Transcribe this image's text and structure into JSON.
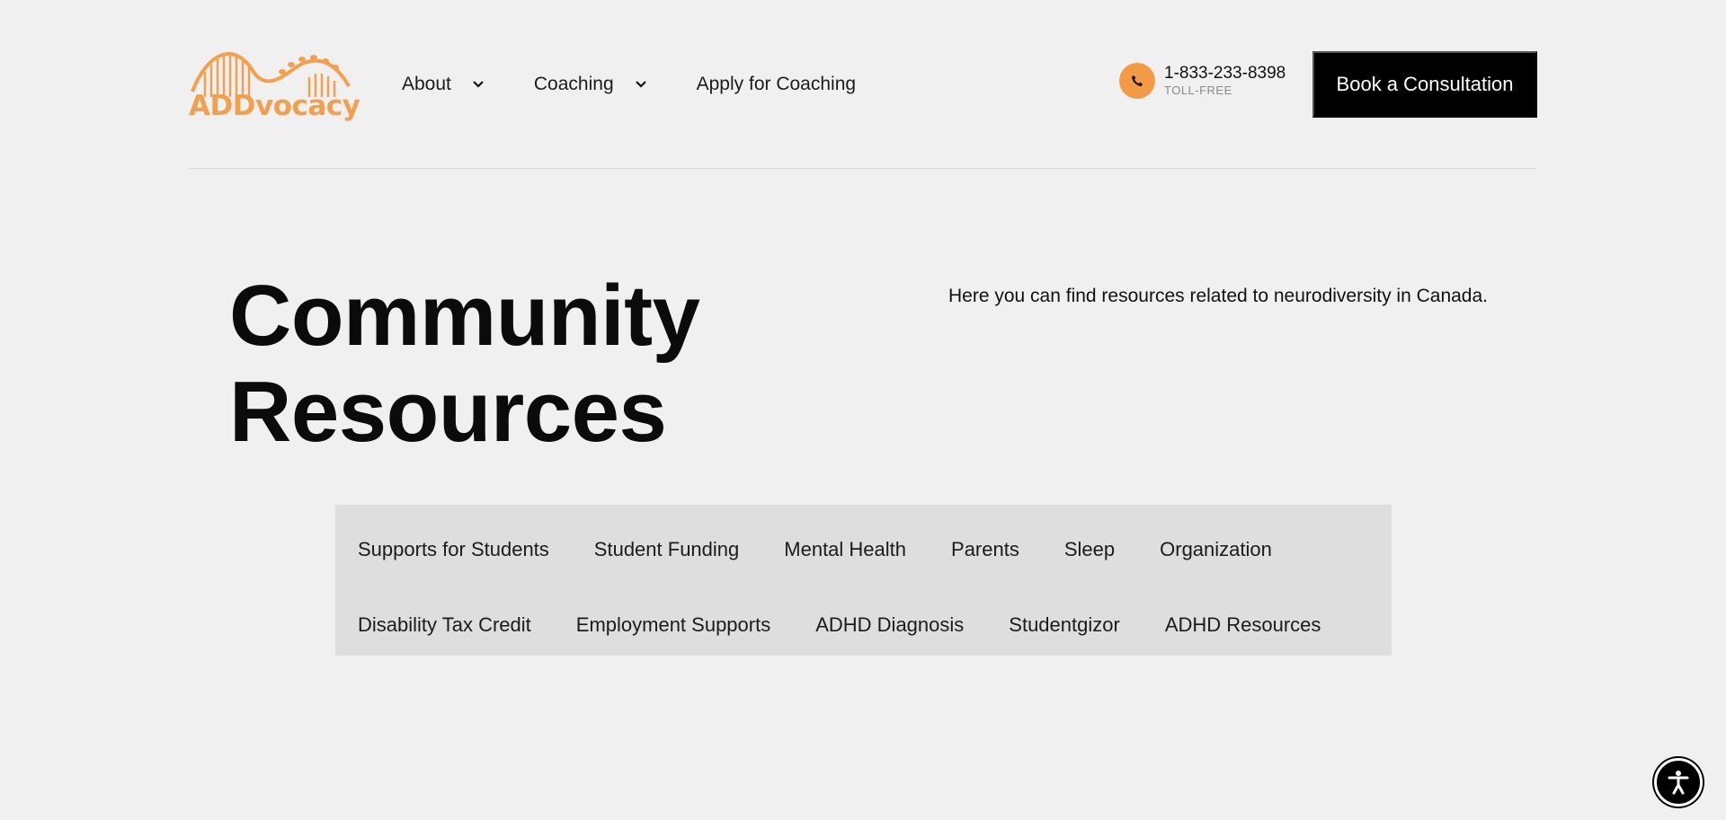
{
  "header": {
    "logo_text": "ADDvocacy",
    "nav": [
      {
        "label": "About",
        "has_dropdown": true
      },
      {
        "label": "Coaching",
        "has_dropdown": true
      },
      {
        "label": "Apply for Coaching",
        "has_dropdown": false
      }
    ],
    "phone_number": "1-833-233-8398",
    "phone_caption": "TOLL-FREE",
    "cta_label": "Book a Consultation"
  },
  "hero": {
    "title_line1": "Community",
    "title_line2": "Resources",
    "intro": "Here you can find resources related to neurodiversity in Canada."
  },
  "tabs": {
    "row1": [
      "Supports for Students",
      "Student Funding",
      "Mental Health",
      "Parents",
      "Sleep",
      "Organization"
    ],
    "row2": [
      "Disability Tax Credit",
      "Employment Supports",
      "ADHD Diagnosis",
      "Studentgizor",
      "ADHD Resources"
    ]
  },
  "colors": {
    "brand_orange": "#f3a04e",
    "background": "#f0f0f0",
    "cta_bg": "#000000",
    "tabs_bg": "#dedede"
  },
  "icons": [
    "logo-rollercoaster-icon",
    "chevron-down-icon",
    "phone-icon",
    "accessibility-icon"
  ]
}
